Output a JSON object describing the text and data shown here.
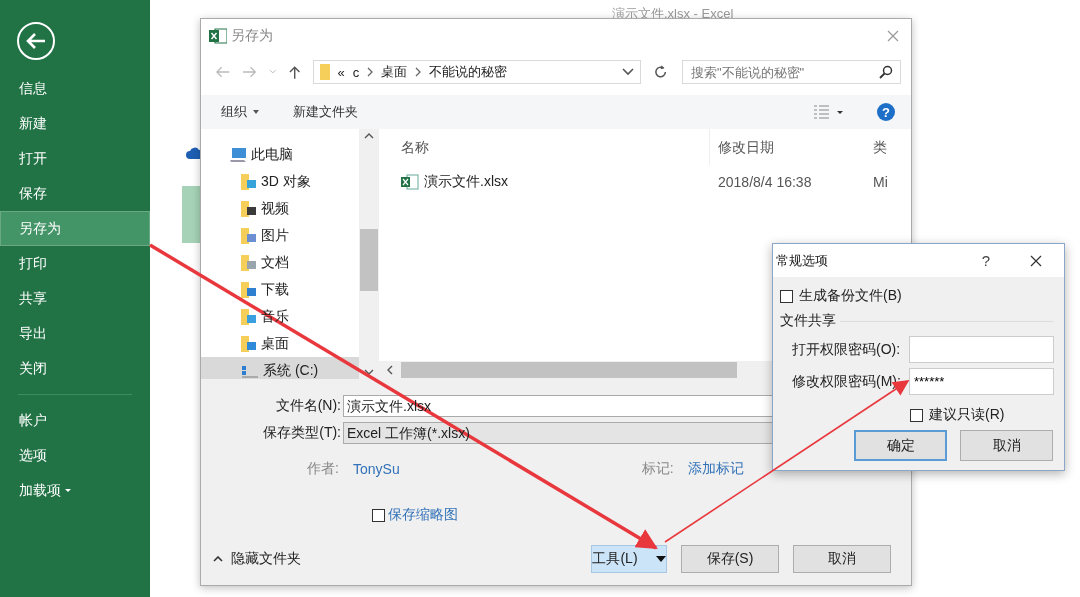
{
  "backstage": {
    "window_title": "演示文件.xlsx - Excel",
    "menu": [
      {
        "label": "信息",
        "selected": false,
        "dropdown": false
      },
      {
        "label": "新建",
        "selected": false,
        "dropdown": false
      },
      {
        "label": "打开",
        "selected": false,
        "dropdown": false
      },
      {
        "label": "保存",
        "selected": false,
        "dropdown": false
      },
      {
        "label": "另存为",
        "selected": true,
        "dropdown": false
      },
      {
        "label": "打印",
        "selected": false,
        "dropdown": false
      },
      {
        "label": "共享",
        "selected": false,
        "dropdown": false
      },
      {
        "label": "导出",
        "selected": false,
        "dropdown": false
      },
      {
        "label": "关闭",
        "selected": false,
        "dropdown": false
      }
    ],
    "menu_bottom": [
      {
        "label": "帐户",
        "selected": false,
        "dropdown": false
      },
      {
        "label": "选项",
        "selected": false,
        "dropdown": false
      },
      {
        "label": "加载项",
        "selected": false,
        "dropdown": true
      }
    ]
  },
  "save_dialog": {
    "title": "另存为",
    "address": {
      "prefix": "«",
      "segments": [
        "c",
        "桌面",
        "不能说的秘密"
      ]
    },
    "search": {
      "placeholder": "搜索\"不能说的秘密\""
    },
    "toolbar": {
      "organize": "组织",
      "new_folder": "新建文件夹",
      "help": "?"
    },
    "tree": [
      {
        "label": "此电脑",
        "kind": "pc",
        "selected": false
      },
      {
        "label": "3D 对象",
        "kind": "objects",
        "selected": false
      },
      {
        "label": "视频",
        "kind": "video",
        "selected": false
      },
      {
        "label": "图片",
        "kind": "picture",
        "selected": false
      },
      {
        "label": "文档",
        "kind": "doc",
        "selected": false
      },
      {
        "label": "下载",
        "kind": "download",
        "selected": false
      },
      {
        "label": "音乐",
        "kind": "music",
        "selected": false
      },
      {
        "label": "桌面",
        "kind": "desktop",
        "selected": false
      },
      {
        "label": "系统 (C:)",
        "kind": "drive",
        "selected": true
      }
    ],
    "columns": [
      "名称",
      "修改日期",
      "类"
    ],
    "files": [
      {
        "name": "演示文件.xlsx",
        "modified": "2018/8/4 16:38",
        "column_3": "Mi"
      }
    ],
    "file_name": {
      "label": "文件名(N):",
      "value": "演示文件.xlsx"
    },
    "file_type": {
      "label": "保存类型(T):",
      "value": "Excel 工作簿(*.xlsx)"
    },
    "author": {
      "label": "作者:",
      "value": "TonySu"
    },
    "tags": {
      "label": "标记:",
      "value": "添加标记"
    },
    "thumbnail": {
      "label": "保存缩略图",
      "checked": false
    },
    "hide_folders": "隐藏文件夹",
    "buttons": {
      "tools": "工具(L)",
      "save": "保存(S)",
      "cancel": "取消"
    }
  },
  "options_dialog": {
    "title": "常规选项",
    "help": "?",
    "backup": {
      "label": "生成备份文件(B)",
      "checked": false
    },
    "group": "文件共享",
    "open_password": {
      "label": "打开权限密码(O):"
    },
    "modify_password": {
      "label": "修改权限密码(M):",
      "value": "******"
    },
    "read_only": {
      "label": "建议只读(R)",
      "checked": false
    },
    "buttons": {
      "ok": "确定",
      "cancel": "取消"
    }
  }
}
